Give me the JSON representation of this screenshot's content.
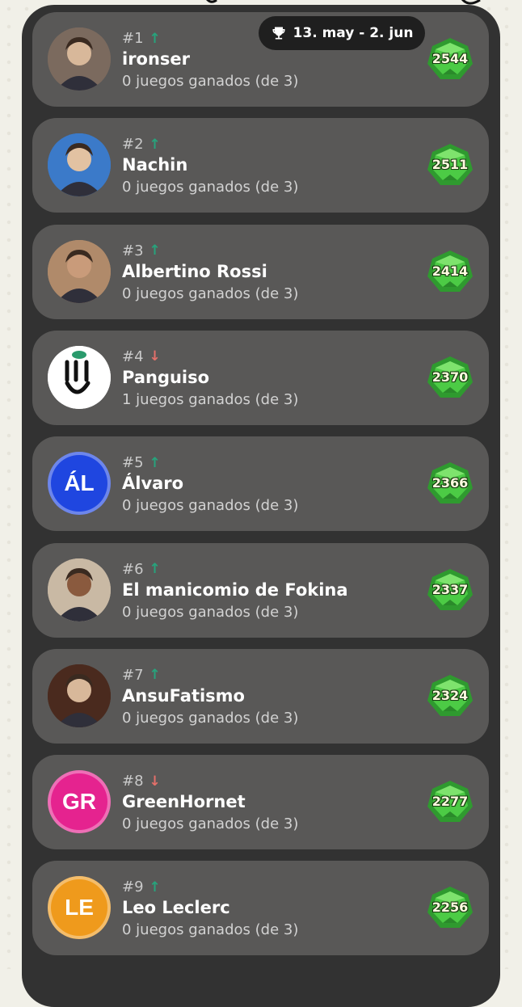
{
  "header": {
    "date_range": "13. may - 2. jun",
    "trophy_icon": "trophy-icon"
  },
  "colors": {
    "panel": "#323232",
    "card": "#595857",
    "up": "#27a37c",
    "down": "#e4706a",
    "gem": "#3fbf43"
  },
  "players": [
    {
      "rank": "#1",
      "trend": "up",
      "name": "ironser",
      "wins": "0 juegos ganados (de 3)",
      "score": "2544",
      "avatar": {
        "type": "photo",
        "bg": "#7b6a5e"
      }
    },
    {
      "rank": "#2",
      "trend": "up",
      "name": "Nachin",
      "wins": "0 juegos ganados (de 3)",
      "score": "2511",
      "avatar": {
        "type": "photo",
        "bg": "#3b7ac9"
      }
    },
    {
      "rank": "#3",
      "trend": "up",
      "name": "Albertino Rossi",
      "wins": "0 juegos ganados (de 3)",
      "score": "2414",
      "avatar": {
        "type": "photo",
        "bg": "#b08a6a"
      }
    },
    {
      "rank": "#4",
      "trend": "down",
      "name": "Panguiso",
      "wins": "1 juegos ganados (de 3)",
      "score": "2370",
      "avatar": {
        "type": "logo",
        "bg": "#ffffff"
      }
    },
    {
      "rank": "#5",
      "trend": "up",
      "name": "Álvaro",
      "wins": "0 juegos ganados (de 3)",
      "score": "2366",
      "avatar": {
        "type": "initials",
        "initials": "ÁL",
        "bg": "#1f46e0"
      }
    },
    {
      "rank": "#6",
      "trend": "up",
      "name": "El manicomio de Fokina",
      "wins": "0 juegos ganados (de 3)",
      "score": "2337",
      "avatar": {
        "type": "photo",
        "bg": "#c9b9a4"
      }
    },
    {
      "rank": "#7",
      "trend": "up",
      "name": "AnsuFatismo",
      "wins": "0 juegos ganados (de 3)",
      "score": "2324",
      "avatar": {
        "type": "photo",
        "bg": "#4a2a1e"
      }
    },
    {
      "rank": "#8",
      "trend": "down",
      "name": "GreenHornet",
      "wins": "0 juegos ganados (de 3)",
      "score": "2277",
      "avatar": {
        "type": "initials",
        "initials": "GR",
        "bg": "#e5238f"
      }
    },
    {
      "rank": "#9",
      "trend": "up",
      "name": "Leo Leclerc",
      "wins": "0 juegos ganados (de 3)",
      "score": "2256",
      "avatar": {
        "type": "initials",
        "initials": "LE",
        "bg": "#ef9a1c"
      }
    }
  ]
}
